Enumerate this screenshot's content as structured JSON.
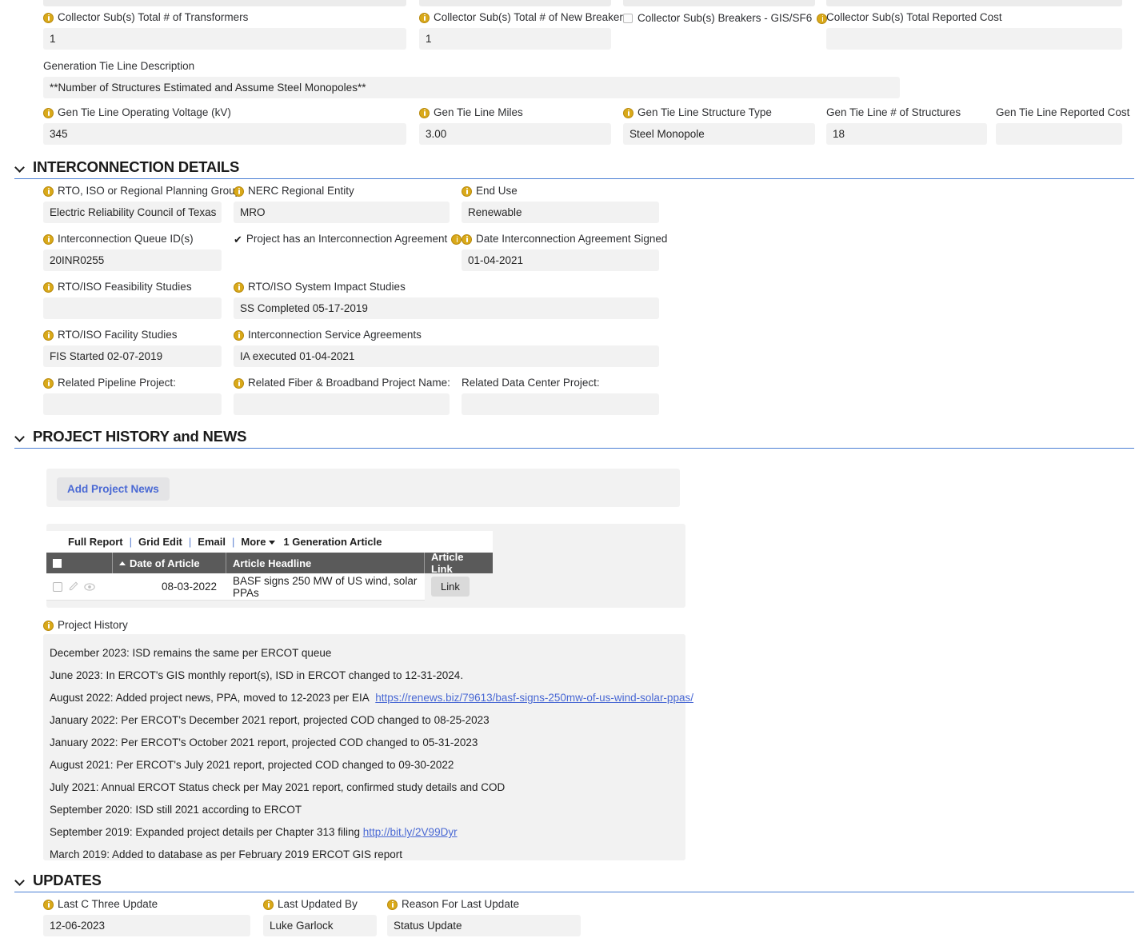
{
  "colors": {
    "accent_blue": "#4a7fd4",
    "link_blue": "#4a69d4",
    "info_icon_gold": "#d9a91a",
    "field_bg": "#f2f2f2",
    "table_header_bg": "#5a5a5a"
  },
  "collector_section": {
    "fields": [
      {
        "label": "Collector Sub(s) Total # of Transformers",
        "value": "1",
        "has_info": true
      },
      {
        "label": "Collector Sub(s) Total # of New Breakers",
        "value": "1",
        "has_info": true
      },
      {
        "label": "Collector Sub(s) Total Reported Cost",
        "value": "",
        "has_info": false
      }
    ],
    "checkbox": {
      "label": "Collector Sub(s) Breakers - GIS/SF6",
      "checked": false,
      "has_info": true
    },
    "gen_tie_description": {
      "label": "Generation Tie Line Description",
      "value": "**Number of Structures Estimated and Assume Steel Monopoles**",
      "has_info": false
    },
    "gen_tie_fields": [
      {
        "label": "Gen Tie Line Operating Voltage (kV)",
        "value": "345",
        "has_info": true
      },
      {
        "label": "Gen Tie Line Miles",
        "value": "3.00",
        "has_info": true
      },
      {
        "label": "Gen Tie Line Structure Type",
        "value": "Steel Monopole",
        "has_info": true
      },
      {
        "label": "Gen Tie Line # of Structures",
        "value": "18",
        "has_info": false
      },
      {
        "label": "Gen Tie Line Reported Cost",
        "value": "",
        "has_info": false
      }
    ]
  },
  "interconnection": {
    "title": "INTERCONNECTION DETAILS",
    "row1": [
      {
        "label": "RTO, ISO or Regional Planning Group",
        "value": "Electric Reliability Council of Texas",
        "has_info": true
      },
      {
        "label": "NERC Regional Entity",
        "value": "MRO",
        "has_info": true
      },
      {
        "label": "End Use",
        "value": "Renewable",
        "has_info": true
      }
    ],
    "row2": {
      "queue": {
        "label": "Interconnection Queue ID(s)",
        "value": "20INR0255",
        "has_info": true
      },
      "agreement_checkbox": {
        "label": "Project has an Interconnection Agreement",
        "checked": true,
        "has_info": true
      },
      "date_signed": {
        "label": "Date Interconnection Agreement Signed",
        "value": "01-04-2021",
        "has_info": true
      }
    },
    "row3": [
      {
        "label": "RTO/ISO Feasibility Studies",
        "value": "",
        "has_info": true
      },
      {
        "label": "RTO/ISO System Impact Studies",
        "value": "SS Completed 05-17-2019",
        "has_info": true
      }
    ],
    "row4": [
      {
        "label": "RTO/ISO Facility Studies",
        "value": "FIS Started 02-07-2019",
        "has_info": true
      },
      {
        "label": "Interconnection Service Agreements",
        "value": "IA executed 01-04-2021",
        "has_info": true
      }
    ],
    "row5": [
      {
        "label": "Related Pipeline Project:",
        "value": "",
        "has_info": true
      },
      {
        "label": "Related Fiber & Broadband Project Name:",
        "value": "",
        "has_info": true
      },
      {
        "label": "Related Data Center Project:",
        "value": "",
        "has_info": false
      }
    ]
  },
  "project_history_news": {
    "title": "PROJECT HISTORY and NEWS",
    "add_button_label": "Add Project News",
    "table": {
      "toolbar": {
        "full_report": "Full Report",
        "grid_edit": "Grid Edit",
        "email": "Email",
        "more": "More",
        "count_label": "1 Generation Article"
      },
      "columns": [
        "",
        "Date of Article",
        "Article Headline",
        "Article Link"
      ],
      "sort_column": "Date of Article",
      "sort_direction": "asc",
      "rows": [
        {
          "date": "08-03-2022",
          "headline": "BASF signs 250 MW of US wind, solar PPAs",
          "link_label": "Link",
          "selected": false
        }
      ]
    },
    "history_label": "Project History",
    "history_lines": [
      {
        "text": "December 2023: ISD remains the same per ERCOT queue",
        "link_text": "",
        "link_href": ""
      },
      {
        "text": "June 2023: In ERCOT's GIS monthly report(s), ISD in ERCOT changed to 12-31-2024.",
        "link_text": "",
        "link_href": ""
      },
      {
        "text": "August 2022: Added project news, PPA, moved to 12-2023 per EIA",
        "link_text": "https://renews.biz/79613/basf-signs-250mw-of-us-wind-solar-ppas/",
        "link_href": "https://renews.biz/79613/basf-signs-250mw-of-us-wind-solar-ppas/"
      },
      {
        "text": "January 2022: Per ERCOT's December 2021 report,  projected COD changed to 08-25-2023",
        "link_text": "",
        "link_href": ""
      },
      {
        "text": "January 2022: Per ERCOT's October 2021 report,  projected COD changed to 05-31-2023",
        "link_text": "",
        "link_href": ""
      },
      {
        "text": "August 2021: Per ERCOT's July 2021 report,  projected COD changed to 09-30-2022",
        "link_text": "",
        "link_href": ""
      },
      {
        "text": "July 2021: Annual ERCOT Status check per May 2021 report, confirmed study details and COD",
        "link_text": "",
        "link_href": ""
      },
      {
        "text": "September 2020: ISD still 2021 according to ERCOT",
        "link_text": "",
        "link_href": ""
      },
      {
        "text": "September 2019: Expanded project details per Chapter 313 filing",
        "link_text": "http://bit.ly/2V99Dyr",
        "link_href": "http://bit.ly/2V99Dyr"
      },
      {
        "text": "March 2019: Added to database as per February 2019 ERCOT GIS report",
        "link_text": "",
        "link_href": ""
      }
    ]
  },
  "updates": {
    "title": "UPDATES",
    "fields": [
      {
        "label": "Last C Three Update",
        "value": "12-06-2023",
        "has_info": true
      },
      {
        "label": "Last Updated By",
        "value": "Luke Garlock",
        "has_info": true
      },
      {
        "label": "Reason For Last Update",
        "value": "Status Update",
        "has_info": true
      }
    ]
  }
}
